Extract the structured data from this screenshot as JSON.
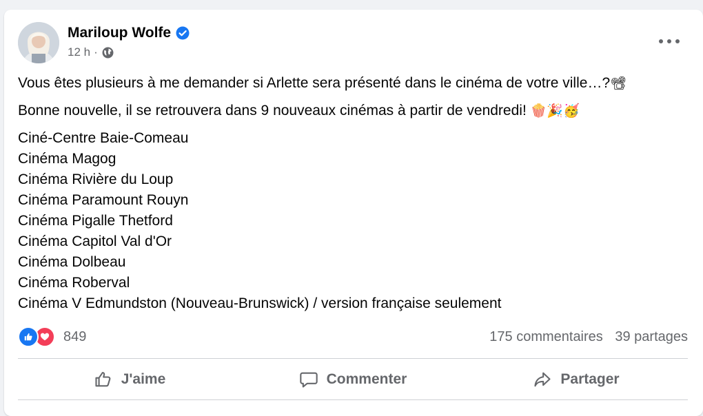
{
  "post": {
    "author": "Mariloup Wolfe",
    "time": "12 h",
    "separator": "·",
    "paragraphs": [
      "Vous êtes plusieurs à me demander si Arlette sera présenté dans le cinéma de votre ville…?",
      "Bonne nouvelle, il se retrouvera dans 9 nouveaux cinémas à partir de vendredi!"
    ],
    "emojis": {
      "p1": "📽",
      "p2": "🍿🎉🥳"
    },
    "cinemas": [
      "Ciné-Centre Baie-Comeau",
      "Cinéma Magog",
      "Cinéma Rivière du Loup",
      "Cinéma Paramount Rouyn",
      "Cinéma Pigalle Thetford",
      "Cinéma Capitol Val d'Or",
      "Cinéma Dolbeau",
      "Cinéma Roberval",
      "Cinéma V Edmundston (Nouveau-Brunswick) / version française seulement"
    ]
  },
  "stats": {
    "reactions_count": "849",
    "comments": "175 commentaires",
    "shares": "39 partages"
  },
  "actions": {
    "like": "J'aime",
    "comment": "Commenter",
    "share": "Partager"
  },
  "icons": {
    "verified": "verified-badge-icon",
    "audience": "globe-icon",
    "more": "more-options-icon",
    "like": "thumbs-up-icon",
    "comment": "comment-bubble-icon",
    "share": "share-arrow-icon"
  },
  "colors": {
    "brand_blue": "#1877f2",
    "love_red": "#f33e58",
    "secondary_text": "#65676b",
    "divider": "#ced0d4"
  }
}
